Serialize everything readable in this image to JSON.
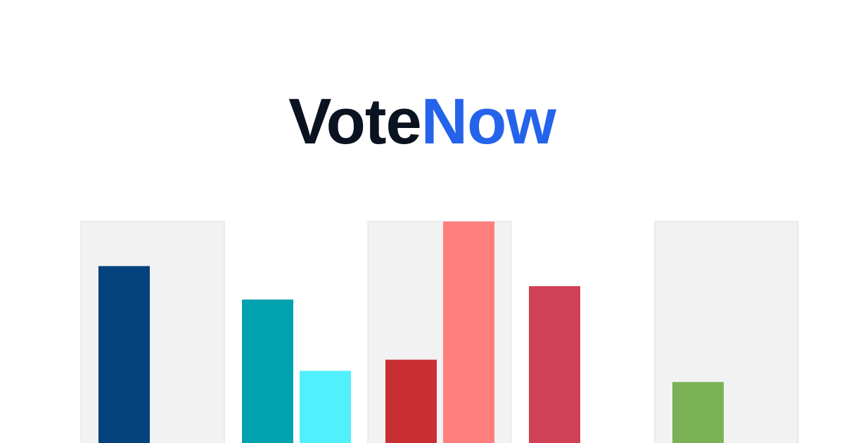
{
  "brand": {
    "name_part1": "Vote",
    "name_part2": "Now",
    "color_dark": "#0b1220",
    "color_blue": "#2563eb"
  },
  "chart_data": {
    "type": "bar",
    "grid": false,
    "legend": "none",
    "ylim": [
      0,
      100
    ],
    "panel_color_shaded": "#f2f2f2",
    "panel_border_color": "#dddddd",
    "groups": [
      {
        "shaded": true,
        "bars": [
          {
            "value": 80,
            "color": "#04427e"
          }
        ]
      },
      {
        "shaded": false,
        "bars": [
          {
            "value": 65,
            "color": "#00a2b0"
          },
          {
            "value": 33,
            "color": "#52f0fc"
          }
        ]
      },
      {
        "shaded": true,
        "bars": [
          {
            "value": 38,
            "color": "#c82f33"
          },
          {
            "value": 100,
            "color": "#ff7f7f"
          }
        ]
      },
      {
        "shaded": false,
        "bars": [
          {
            "value": 71,
            "color": "#d04157"
          }
        ]
      },
      {
        "shaded": true,
        "bars": [
          {
            "value": 28,
            "color": "#7bb256"
          }
        ]
      }
    ]
  }
}
